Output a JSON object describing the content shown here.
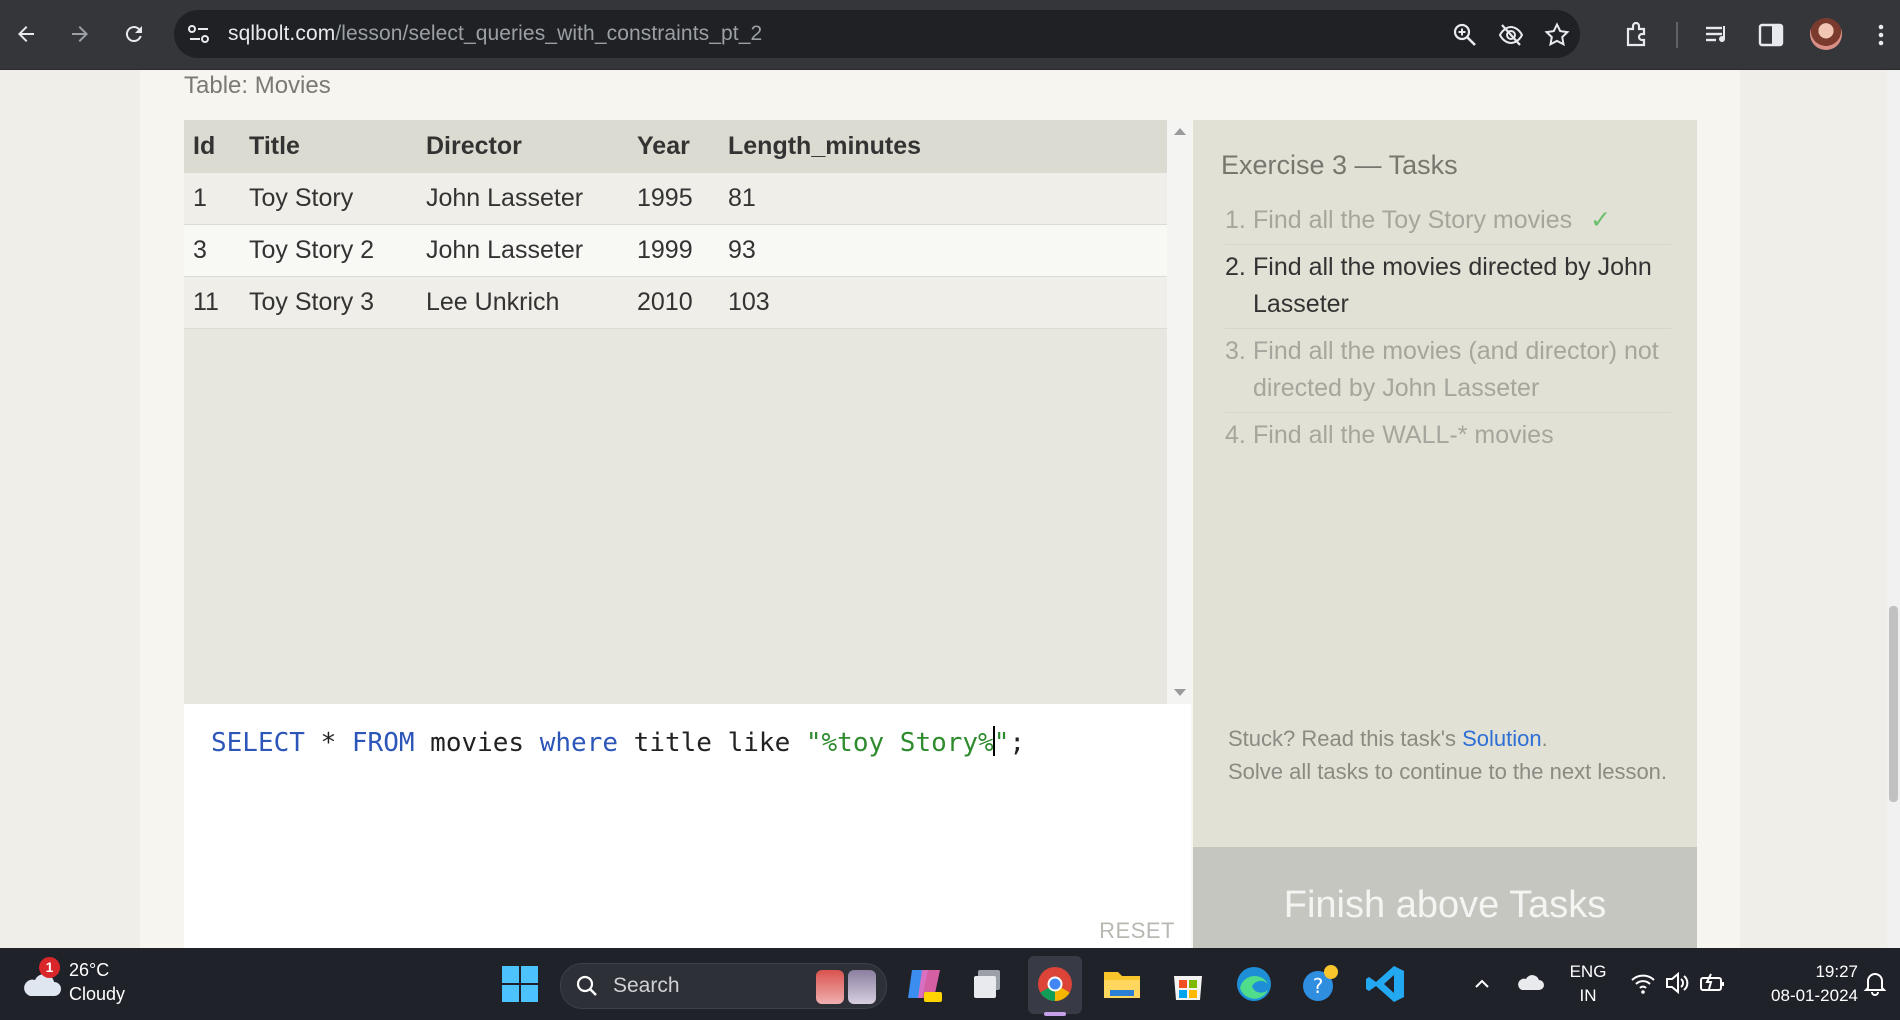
{
  "browser": {
    "url_host": "sqlbolt.com",
    "url_path": "/lesson/select_queries_with_constraints_pt_2"
  },
  "table": {
    "caption": "Table: Movies",
    "columns": [
      "Id",
      "Title",
      "Director",
      "Year",
      "Length_minutes"
    ],
    "rows": [
      [
        "1",
        "Toy Story",
        "John Lasseter",
        "1995",
        "81"
      ],
      [
        "3",
        "Toy Story 2",
        "John Lasseter",
        "1999",
        "93"
      ],
      [
        "11",
        "Toy Story 3",
        "Lee Unkrich",
        "2010",
        "103"
      ]
    ]
  },
  "editor": {
    "kw_select": "SELECT",
    "op_star": " * ",
    "kw_from": "FROM",
    "ident_movies": " movies ",
    "kw_where": "where",
    "ident_title": " title like ",
    "str_before_caret": "\"%toy Story%",
    "str_after_caret": "\"",
    "terminator": ";",
    "reset_label": "RESET"
  },
  "tasks": {
    "title": "Exercise 3 — Tasks",
    "items": [
      {
        "num": "1.",
        "text": "Find all the Toy Story movies",
        "status": "done"
      },
      {
        "num": "2.",
        "text": "Find all the movies directed by John Lasseter",
        "status": "active"
      },
      {
        "num": "3.",
        "text": "Find all the movies (and director) not directed by John Lasseter",
        "status": "pending"
      },
      {
        "num": "4.",
        "text": "Find all the WALL-* movies",
        "status": "pending"
      }
    ],
    "check_mark": "✓",
    "stuck_prefix": "Stuck? Read this task's ",
    "solution_link": "Solution",
    "stuck_period": ".",
    "stuck_line2": "Solve all tasks to continue to the next lesson.",
    "finish_button": "Finish above Tasks"
  },
  "taskbar": {
    "weather_temp": "26°C",
    "weather_desc": "Cloudy",
    "weather_badge": "1",
    "search_label": "Search",
    "lang_top": "ENG",
    "lang_bottom": "IN",
    "time": "19:27",
    "date": "08-01-2024"
  },
  "colors": {
    "keyword": "#2c56b8",
    "string": "#2e8b2e",
    "link": "#2d6fd6",
    "check": "#6cbf6c",
    "finish_button_bg": "#c6c6c0"
  }
}
